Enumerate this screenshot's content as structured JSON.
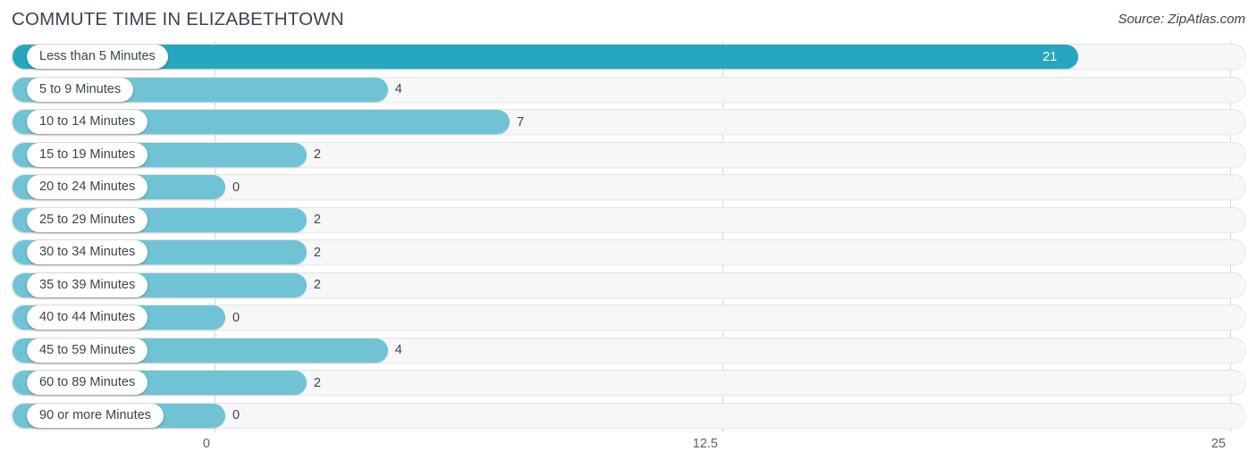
{
  "header": {
    "title": "COMMUTE TIME IN ELIZABETHTOWN",
    "source": "Source: ZipAtlas.com"
  },
  "axis": {
    "ticks": [
      "0",
      "12.5",
      "25"
    ]
  },
  "chart_data": {
    "type": "bar",
    "orientation": "horizontal",
    "title": "COMMUTE TIME IN ELIZABETHTOWN",
    "subtitle": "Source: ZipAtlas.com",
    "xlabel": "",
    "ylabel": "",
    "xlim": [
      0,
      25
    ],
    "xticks": [
      0,
      12.5,
      25
    ],
    "grid": true,
    "legend": false,
    "categories": [
      "Less than 5 Minutes",
      "5 to 9 Minutes",
      "10 to 14 Minutes",
      "15 to 19 Minutes",
      "20 to 24 Minutes",
      "25 to 29 Minutes",
      "30 to 34 Minutes",
      "35 to 39 Minutes",
      "40 to 44 Minutes",
      "45 to 59 Minutes",
      "60 to 89 Minutes",
      "90 or more Minutes"
    ],
    "values": [
      21,
      4,
      7,
      2,
      0,
      2,
      2,
      2,
      0,
      4,
      2,
      0
    ],
    "value_labels": [
      "21",
      "4",
      "7",
      "2",
      "0",
      "2",
      "2",
      "2",
      "0",
      "4",
      "2",
      "0"
    ],
    "colors": {
      "bar": "#6fc3d4",
      "bar_max": "#24a7bf",
      "track": "#f7f7f7",
      "text": "#3c4450",
      "gridline": "#d8d8d8"
    }
  },
  "rows": [
    {
      "label": "Less than 5 Minutes",
      "value": 21,
      "value_label": "21",
      "inside": true
    },
    {
      "label": "5 to 9 Minutes",
      "value": 4,
      "value_label": "4",
      "inside": false
    },
    {
      "label": "10 to 14 Minutes",
      "value": 7,
      "value_label": "7",
      "inside": false
    },
    {
      "label": "15 to 19 Minutes",
      "value": 2,
      "value_label": "2",
      "inside": false
    },
    {
      "label": "20 to 24 Minutes",
      "value": 0,
      "value_label": "0",
      "inside": false
    },
    {
      "label": "25 to 29 Minutes",
      "value": 2,
      "value_label": "2",
      "inside": false
    },
    {
      "label": "30 to 34 Minutes",
      "value": 2,
      "value_label": "2",
      "inside": false
    },
    {
      "label": "35 to 39 Minutes",
      "value": 2,
      "value_label": "2",
      "inside": false
    },
    {
      "label": "40 to 44 Minutes",
      "value": 0,
      "value_label": "0",
      "inside": false
    },
    {
      "label": "45 to 59 Minutes",
      "value": 4,
      "value_label": "4",
      "inside": false
    },
    {
      "label": "60 to 89 Minutes",
      "value": 2,
      "value_label": "2",
      "inside": false
    },
    {
      "label": "90 or more Minutes",
      "value": 0,
      "value_label": "0",
      "inside": false
    }
  ]
}
